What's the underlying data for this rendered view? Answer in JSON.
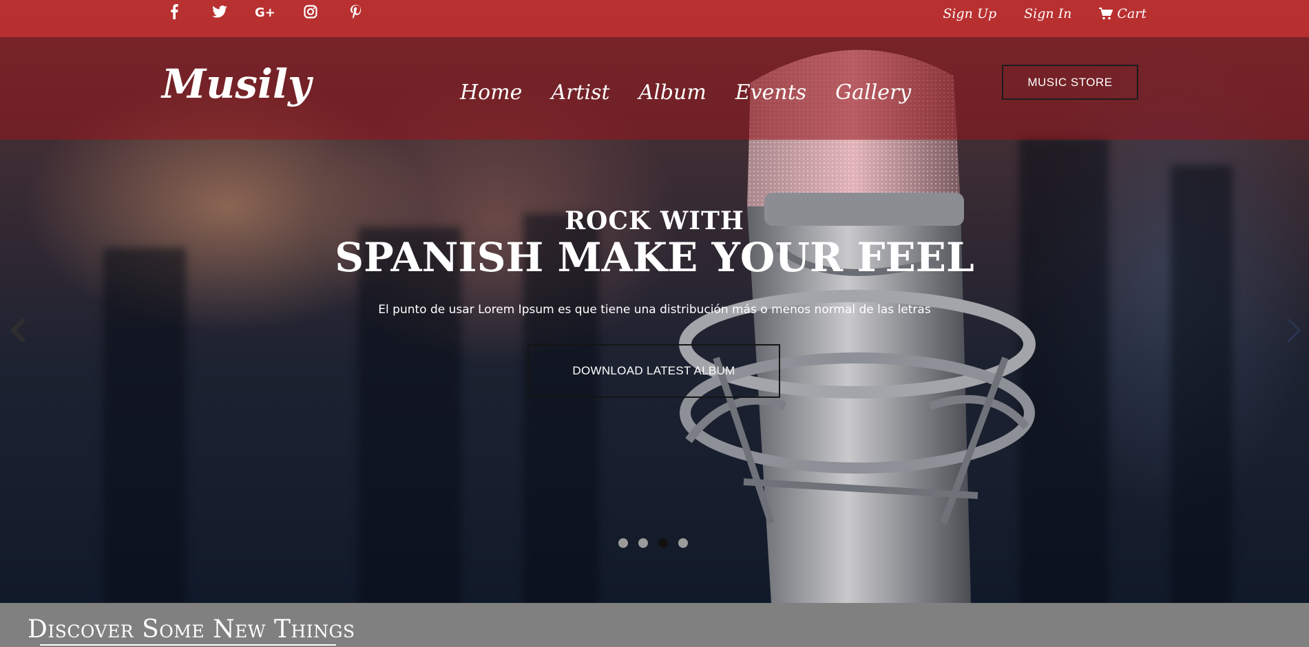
{
  "topbar": {
    "social": [
      {
        "icon": "facebook-icon",
        "glyph": "f"
      },
      {
        "icon": "twitter-icon",
        "glyph": ""
      },
      {
        "icon": "google-plus-icon",
        "glyph": "G+"
      },
      {
        "icon": "instagram-icon",
        "glyph": ""
      },
      {
        "icon": "pinterest-icon",
        "glyph": "p"
      }
    ],
    "sign_up": "Sign Up",
    "sign_in": "Sign In",
    "cart": "Cart"
  },
  "header": {
    "logo": "Musily",
    "nav": [
      "Home",
      "Artist",
      "Album",
      "Events",
      "Gallery"
    ],
    "store_button": "MUSIC STORE"
  },
  "hero": {
    "title_line1": "ROCK WITH",
    "title_line2": "SPANISH MAKE YOUR FEEL",
    "subtitle": "El punto de usar Lorem Ipsum es que tiene una distribución más o menos normal de las letras",
    "cta": "DOWNLOAD LATEST ALBUM",
    "slides_count": 4,
    "active_slide": 3
  },
  "discover": {
    "title": "Discover Some New Things"
  },
  "colors": {
    "topbar": "#de2d2d",
    "header": "#96141c",
    "discover_bg": "#808080",
    "text": "#ffffff"
  }
}
